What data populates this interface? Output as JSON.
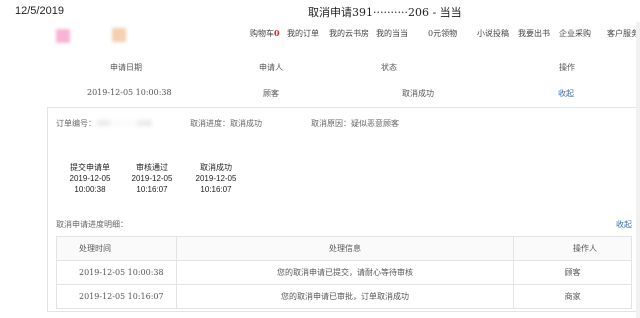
{
  "header": {
    "print_date": "12/5/2019",
    "page_title": "取消申请391··········206 - 当当"
  },
  "nav": {
    "cart": "购物车",
    "cart_count": "0",
    "items": [
      "我的订单",
      "我的云书房",
      "我的当当",
      "0元领物",
      "小说投稿",
      "我要出书",
      "企业采购",
      "客户服务"
    ]
  },
  "application": {
    "headers": [
      "申请日期",
      "申请人",
      "状态",
      "操作"
    ],
    "row": {
      "date": "2019-12-05 10:00:38",
      "applicant": "顾客",
      "status": "取消成功",
      "action": "收起"
    }
  },
  "detail": {
    "order_no_label": "订单编号：",
    "order_no_value": "391··········206",
    "progress": "取消进度：取消成功",
    "reason": "取消原因：疑似恶意顾客",
    "steps": [
      {
        "label": "提交申请单",
        "date": "2019-12-05",
        "time": "10:00:38"
      },
      {
        "label": "审核通过",
        "date": "2019-12-05",
        "time": "10:16:07"
      },
      {
        "label": "取消成功",
        "date": "2019-12-05",
        "time": "10:16:07"
      }
    ],
    "progress_detail_label": "取消申请进度明细：",
    "collapse": "收起"
  },
  "history": {
    "headers": [
      "处理时间",
      "处理信息",
      "操作人"
    ],
    "rows": [
      {
        "time": "2019-12-05 10:00:38",
        "info": "您的取消申请已提交，请耐心等待审核",
        "operator": "顾客"
      },
      {
        "time": "2019-12-05 10:16:07",
        "info": "您的取消申请已审批，订单取消成功",
        "operator": "商家"
      }
    ]
  }
}
